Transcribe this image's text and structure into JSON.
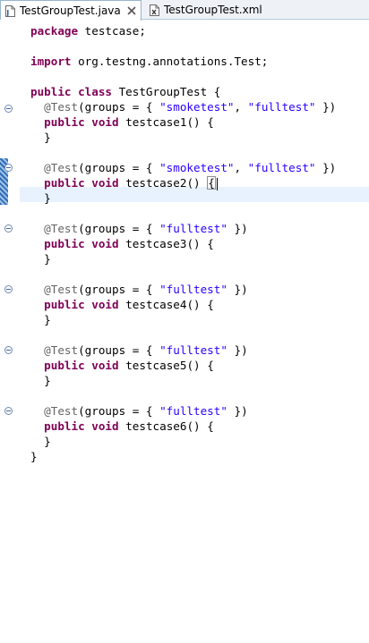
{
  "tabs": [
    {
      "label": "TestGroupTest.java",
      "active": true,
      "icon": "java-file-icon"
    },
    {
      "label": "TestGroupTest.xml",
      "active": false,
      "icon": "xml-file-icon"
    }
  ],
  "code": {
    "package_kw": "package",
    "package_name": " testcase;",
    "import_kw": "import",
    "import_name": " org.testng.annotations.Test;",
    "public_kw": "public",
    "class_kw": "class",
    "class_name": " TestGroupTest {",
    "annotation": "@Test",
    "groups_open": "(groups = { ",
    "smoketest": "\"smoketest\"",
    "comma": ", ",
    "fulltest": "\"fulltest\"",
    "groups_close": " })",
    "void_kw": "void",
    "method_suffix": "() {",
    "method_close": "}",
    "class_close": "}",
    "methods": [
      {
        "name": "testcase1",
        "groups": [
          "\"smoketest\"",
          "\"fulltest\""
        ]
      },
      {
        "name": "testcase2",
        "groups": [
          "\"smoketest\"",
          "\"fulltest\""
        ]
      },
      {
        "name": "testcase3",
        "groups": [
          "\"fulltest\""
        ]
      },
      {
        "name": "testcase4",
        "groups": [
          "\"fulltest\""
        ]
      },
      {
        "name": "testcase5",
        "groups": [
          "\"fulltest\""
        ]
      },
      {
        "name": "testcase6",
        "groups": [
          "\"fulltest\""
        ]
      }
    ]
  },
  "colors": {
    "keyword": "#7f0055",
    "annotation": "#646464",
    "string": "#2a00ff",
    "current_line": "#e8f2fe"
  }
}
